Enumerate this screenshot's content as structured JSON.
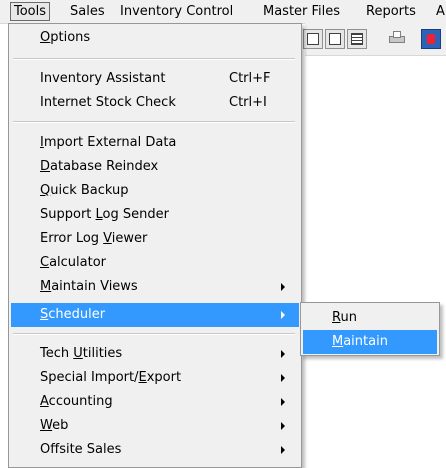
{
  "menubar": {
    "items": [
      {
        "id": "tools",
        "label": "Tools",
        "active": true
      },
      {
        "id": "sales",
        "label": "Sales"
      },
      {
        "id": "inventory",
        "label": "Inventory Control"
      },
      {
        "id": "master",
        "label": "Master Files"
      },
      {
        "id": "reports",
        "label": "Reports"
      },
      {
        "id": "truncated",
        "label": "A"
      }
    ]
  },
  "tools_menu": {
    "items": [
      {
        "id": "options",
        "pre": "",
        "ul": "O",
        "post": "ptions",
        "shortcut": ""
      },
      {
        "id": "inventory-assistant",
        "pre": "Inventory Assistant",
        "ul": "",
        "post": "",
        "shortcut": "Ctrl+F"
      },
      {
        "id": "internet-stock-check",
        "pre": "Internet Stock Check",
        "ul": "",
        "post": "",
        "shortcut": "Ctrl+I"
      },
      {
        "id": "import-external-data",
        "pre": "",
        "ul": "I",
        "post": "mport External Data",
        "shortcut": ""
      },
      {
        "id": "database-reindex",
        "pre": "",
        "ul": "D",
        "post": "atabase Reindex",
        "shortcut": ""
      },
      {
        "id": "quick-backup",
        "pre": "",
        "ul": "Q",
        "post": "uick Backup",
        "shortcut": ""
      },
      {
        "id": "support-log-sender",
        "pre": "Support ",
        "ul": "L",
        "post": "og Sender",
        "shortcut": ""
      },
      {
        "id": "error-log-viewer",
        "pre": "Error Log ",
        "ul": "V",
        "post": "iewer",
        "shortcut": ""
      },
      {
        "id": "calculator",
        "pre": "",
        "ul": "C",
        "post": "alculator",
        "shortcut": ""
      },
      {
        "id": "maintain-views",
        "pre": "",
        "ul": "M",
        "post": "aintain Views",
        "shortcut": ""
      },
      {
        "id": "scheduler",
        "pre": "",
        "ul": "S",
        "post": "cheduler",
        "shortcut": ""
      },
      {
        "id": "tech-utilities",
        "pre": "Tech ",
        "ul": "U",
        "post": "tilities",
        "shortcut": ""
      },
      {
        "id": "special-import-export",
        "pre": "Special Import/",
        "ul": "E",
        "post": "xport",
        "shortcut": ""
      },
      {
        "id": "accounting",
        "pre": "",
        "ul": "A",
        "post": "ccounting",
        "shortcut": ""
      },
      {
        "id": "web",
        "pre": "",
        "ul": "W",
        "post": "eb",
        "shortcut": ""
      },
      {
        "id": "offsite-sales",
        "pre": "Offsite Sales",
        "ul": "",
        "post": "",
        "shortcut": ""
      }
    ]
  },
  "scheduler_submenu": {
    "items": [
      {
        "id": "run",
        "pre": "",
        "ul": "R",
        "post": "un"
      },
      {
        "id": "maintain",
        "pre": "",
        "ul": "M",
        "post": "aintain"
      }
    ]
  },
  "toolbar": {
    "icons": [
      "window-icon",
      "calculator-icon",
      "printer-icon",
      "app-icon"
    ]
  },
  "colors": {
    "highlight": "#3399ff",
    "menu_bg": "#f0f0f0",
    "menu_border": "#979797"
  }
}
